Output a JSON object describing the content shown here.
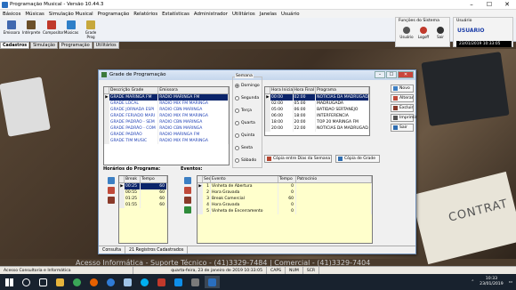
{
  "app": {
    "title": "Programação Musical - Versão 10.44.3",
    "controls": [
      "–",
      "☐",
      "✕"
    ]
  },
  "menu": [
    "Básicos",
    "Músicas",
    "Simulação Musical",
    "Programação",
    "Relatórios",
    "Estatísticas",
    "Administrador",
    "Utilitários",
    "Janelas",
    "Usuário"
  ],
  "toolbar": [
    {
      "label": "Emissora",
      "icon": "radio-tower-icon",
      "color": "#4169b0"
    },
    {
      "label": "Intérprete",
      "icon": "singer-icon",
      "color": "#6b4f2a"
    },
    {
      "label": "Compositor",
      "icon": "composer-icon",
      "color": "#c0392b"
    },
    {
      "label": "Músicas",
      "icon": "music-note-icon",
      "color": "#2e7fc8"
    },
    {
      "label": "Grade Prog",
      "icon": "schedule-grid-icon",
      "color": "#c7a83c"
    }
  ],
  "tabs": [
    "Cadastros",
    "Simulação",
    "Programação",
    "Utilitários"
  ],
  "system_functions": {
    "title": "Funções do Sistema",
    "buttons": [
      {
        "label": "Usuário",
        "icon": "user-icon",
        "color": "#555"
      },
      {
        "label": "Logoff",
        "icon": "logoff-icon",
        "color": "#c0392b"
      },
      {
        "label": "Sair",
        "icon": "exit-icon",
        "color": "#333"
      }
    ]
  },
  "user_box": {
    "title": "Usuário",
    "name": "USUARIO",
    "datetime": "23/01/2019 10:33:05"
  },
  "desk_text": "Acesso Informática - Suporte Técnico - (41)3329-7484 | Comercial - (41)3329-7404",
  "window": {
    "title": "Grade de Programação",
    "controls": [
      "–",
      "☐",
      "✕"
    ],
    "grid_columns": [
      "Descrição Grade",
      "Emissora"
    ],
    "grid_rows": [
      [
        "GRADE MARINGÁ FM",
        "RADIO MARINGA FM"
      ],
      [
        "GRADE LOCAL",
        "RADIO MIX FM MARINGA"
      ],
      [
        "GRADE JORNADA ESPI",
        "RADIO CBN MARINGA"
      ],
      [
        "GRADE FERIADO MARI",
        "RADIO MIX FM MARINGA"
      ],
      [
        "GRADE PADRÃO - SEM",
        "RADIO CBN MARINGA"
      ],
      [
        "GRADE PADRÃO - COM",
        "RADIO CBN MARINGA"
      ],
      [
        "GRADE PADRÃO",
        "RADIO MARINGA FM"
      ],
      [
        "GRADE TIM MUSIC",
        "RADIO MIX FM MARINGA"
      ]
    ],
    "semana": {
      "legend": "Semana",
      "days": [
        "Domingo",
        "Segunda",
        "Terça",
        "Quarta",
        "Quinta",
        "Sexta",
        "Sábado"
      ],
      "selected": "Domingo"
    },
    "sched_columns": [
      "Hora Inicial",
      "Hora Final",
      "Programa"
    ],
    "sched_rows": [
      [
        "00:00",
        "02:00",
        "NOTICIAS DA MADRUGADA"
      ],
      [
        "02:00",
        "05:00",
        "MADRUGADA"
      ],
      [
        "05:00",
        "06:00",
        "BATIDAO SERTANEJO"
      ],
      [
        "06:00",
        "18:00",
        "INTERFERENCIA"
      ],
      [
        "18:00",
        "20:00",
        "TOP 20 MARINGA FM"
      ],
      [
        "20:00",
        "22:00",
        "NOTICIAS DA MADRUGADA"
      ]
    ],
    "side_buttons": [
      "Novo",
      "Alterar",
      "Excluir",
      "Imprimir",
      "Sair"
    ],
    "copy_days_button": "Cópia entre Dias da Semana",
    "copy_grid_button": "Cópia de Grade",
    "horarios": {
      "title": "Horários do Programa:",
      "columns": [
        "Break",
        "Tempo"
      ],
      "rows": [
        [
          "00:25",
          "60"
        ],
        [
          "00:55",
          "60"
        ],
        [
          "01:25",
          "60"
        ],
        [
          "01:55",
          "60"
        ]
      ]
    },
    "eventos": {
      "title": "Eventos:",
      "columns": [
        "Seq",
        "Evento",
        "Tempo",
        "Patrocínio"
      ],
      "rows": [
        [
          "1",
          "Vinheta de Abertura",
          "0",
          ""
        ],
        [
          "2",
          "Hora Gravada",
          "0",
          ""
        ],
        [
          "3",
          "Break Comercial",
          "60",
          ""
        ],
        [
          "4",
          "Hora Gravada",
          "0",
          ""
        ],
        [
          "5",
          "Vinheta de Encerramento",
          "0",
          ""
        ]
      ]
    },
    "footer": {
      "mode": "Consulta",
      "count": "21 Registros Cadastrados"
    }
  },
  "statusbar": [
    "Acesso Consultoria e Informática",
    "quarta-feira, 23 de janeiro de 2019 10:33:05",
    "CAPS",
    "NUM",
    "SCR"
  ],
  "taskbar": {
    "apps": [
      "search",
      "task-view",
      "explorer",
      "chrome",
      "firefox",
      "edge",
      "notepad",
      "skype",
      "app",
      "teamviewer",
      "mail",
      "programacao"
    ],
    "time": "10:33",
    "date": "23/01/2019"
  }
}
